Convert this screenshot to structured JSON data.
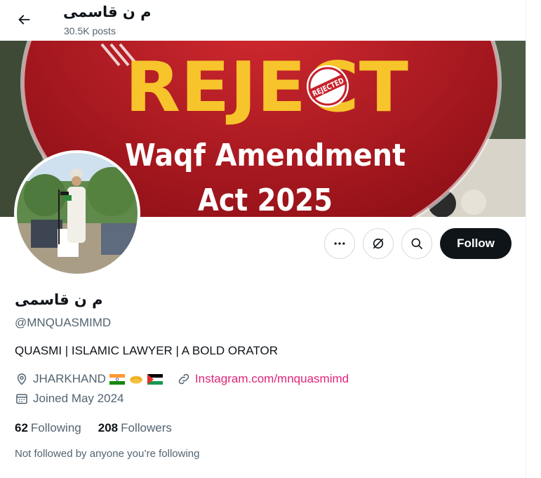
{
  "header": {
    "name": "م ن قاسمی",
    "posts": "30.5K posts"
  },
  "banner": {
    "headline": "REJECT",
    "stamp": "REJECTED",
    "line1": "Waqf Amendment",
    "line2": "Act 2025",
    "colors": {
      "red": "#c8202a",
      "dark_red": "#9e1119",
      "yellow": "#f7c52b"
    }
  },
  "actions": {
    "more_icon": "more-icon",
    "grok_icon": "grok-icon",
    "search_icon": "search-icon",
    "follow_label": "Follow"
  },
  "profile": {
    "name": "م ن قاسمی",
    "handle": "@MNQUASMIMD",
    "bio": "QUASMI | ISLAMIC LAWYER | A BOLD ORATOR",
    "location": "JHARKHAND",
    "location_emoji": [
      "india-flag",
      "handshake",
      "palestine-flag"
    ],
    "link": "Instagram.com/mnquasmimd",
    "joined": "Joined May 2024",
    "following_count": "62",
    "following_label": "Following",
    "followers_count": "208",
    "followers_label": "Followers",
    "not_followed": "Not followed by anyone you’re following"
  },
  "colors": {
    "text": "#0f1419",
    "secondary": "#536471",
    "link": "#e0247a",
    "follow_bg": "#0f1419"
  }
}
